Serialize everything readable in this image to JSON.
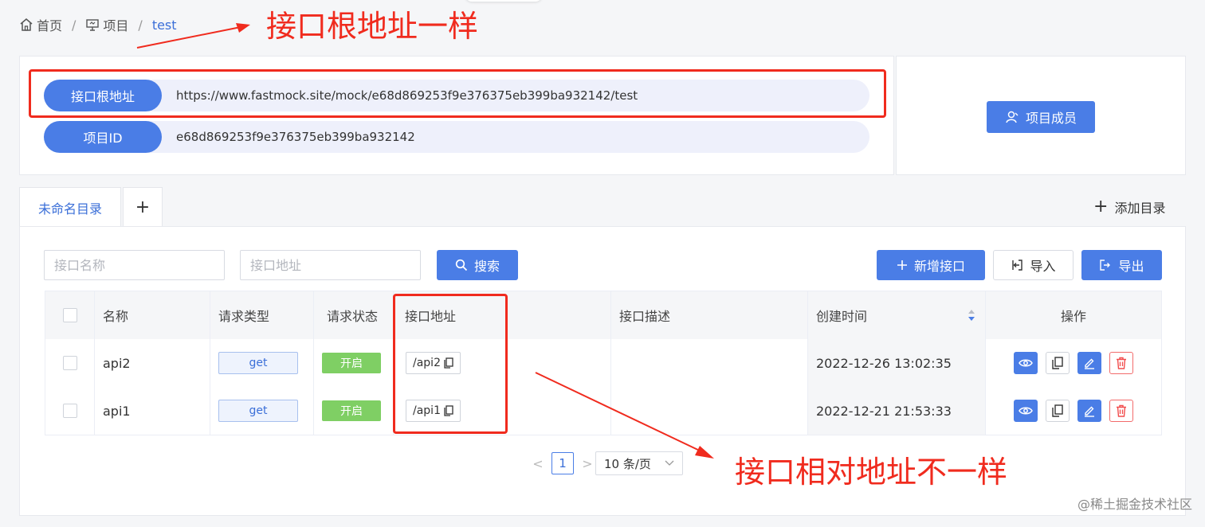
{
  "breadcrumb": {
    "home": "首页",
    "project": "项目",
    "current": "test"
  },
  "annotations": {
    "top": "接口根地址一样",
    "bottom": "接口相对地址不一样"
  },
  "project_info": {
    "base_url_label": "接口根地址",
    "base_url": "https://www.fastmock.site/mock/e68d869253f9e376375eb399ba932142/test",
    "id_label": "项目ID",
    "id": "e68d869253f9e376375eb399ba932142",
    "members_button": "项目成员"
  },
  "tabs": {
    "active": "未命名目录",
    "add_tab": "+",
    "add_dir": "添加目录"
  },
  "toolbar": {
    "name_placeholder": "接口名称",
    "path_placeholder": "接口地址",
    "search": "搜索",
    "new_api": "新增接口",
    "import": "导入",
    "export": "导出"
  },
  "table": {
    "headers": {
      "name": "名称",
      "method": "请求类型",
      "status": "请求状态",
      "path": "接口地址",
      "desc": "接口描述",
      "created": "创建时间",
      "actions": "操作"
    },
    "rows": [
      {
        "name": "api2",
        "method": "get",
        "status": "开启",
        "path": "/api2",
        "desc": "",
        "created": "2022-12-26 13:02:35"
      },
      {
        "name": "api1",
        "method": "get",
        "status": "开启",
        "path": "/api1",
        "desc": "",
        "created": "2022-12-21 21:53:33"
      }
    ]
  },
  "pagination": {
    "prev": "<",
    "page": "1",
    "next": ">",
    "page_size": "10 条/页"
  },
  "watermark": "@稀土掘金技术社区",
  "colors": {
    "primary": "#4a7de6",
    "annotation_red": "#f02b1e",
    "status_green": "#7fcf64"
  }
}
